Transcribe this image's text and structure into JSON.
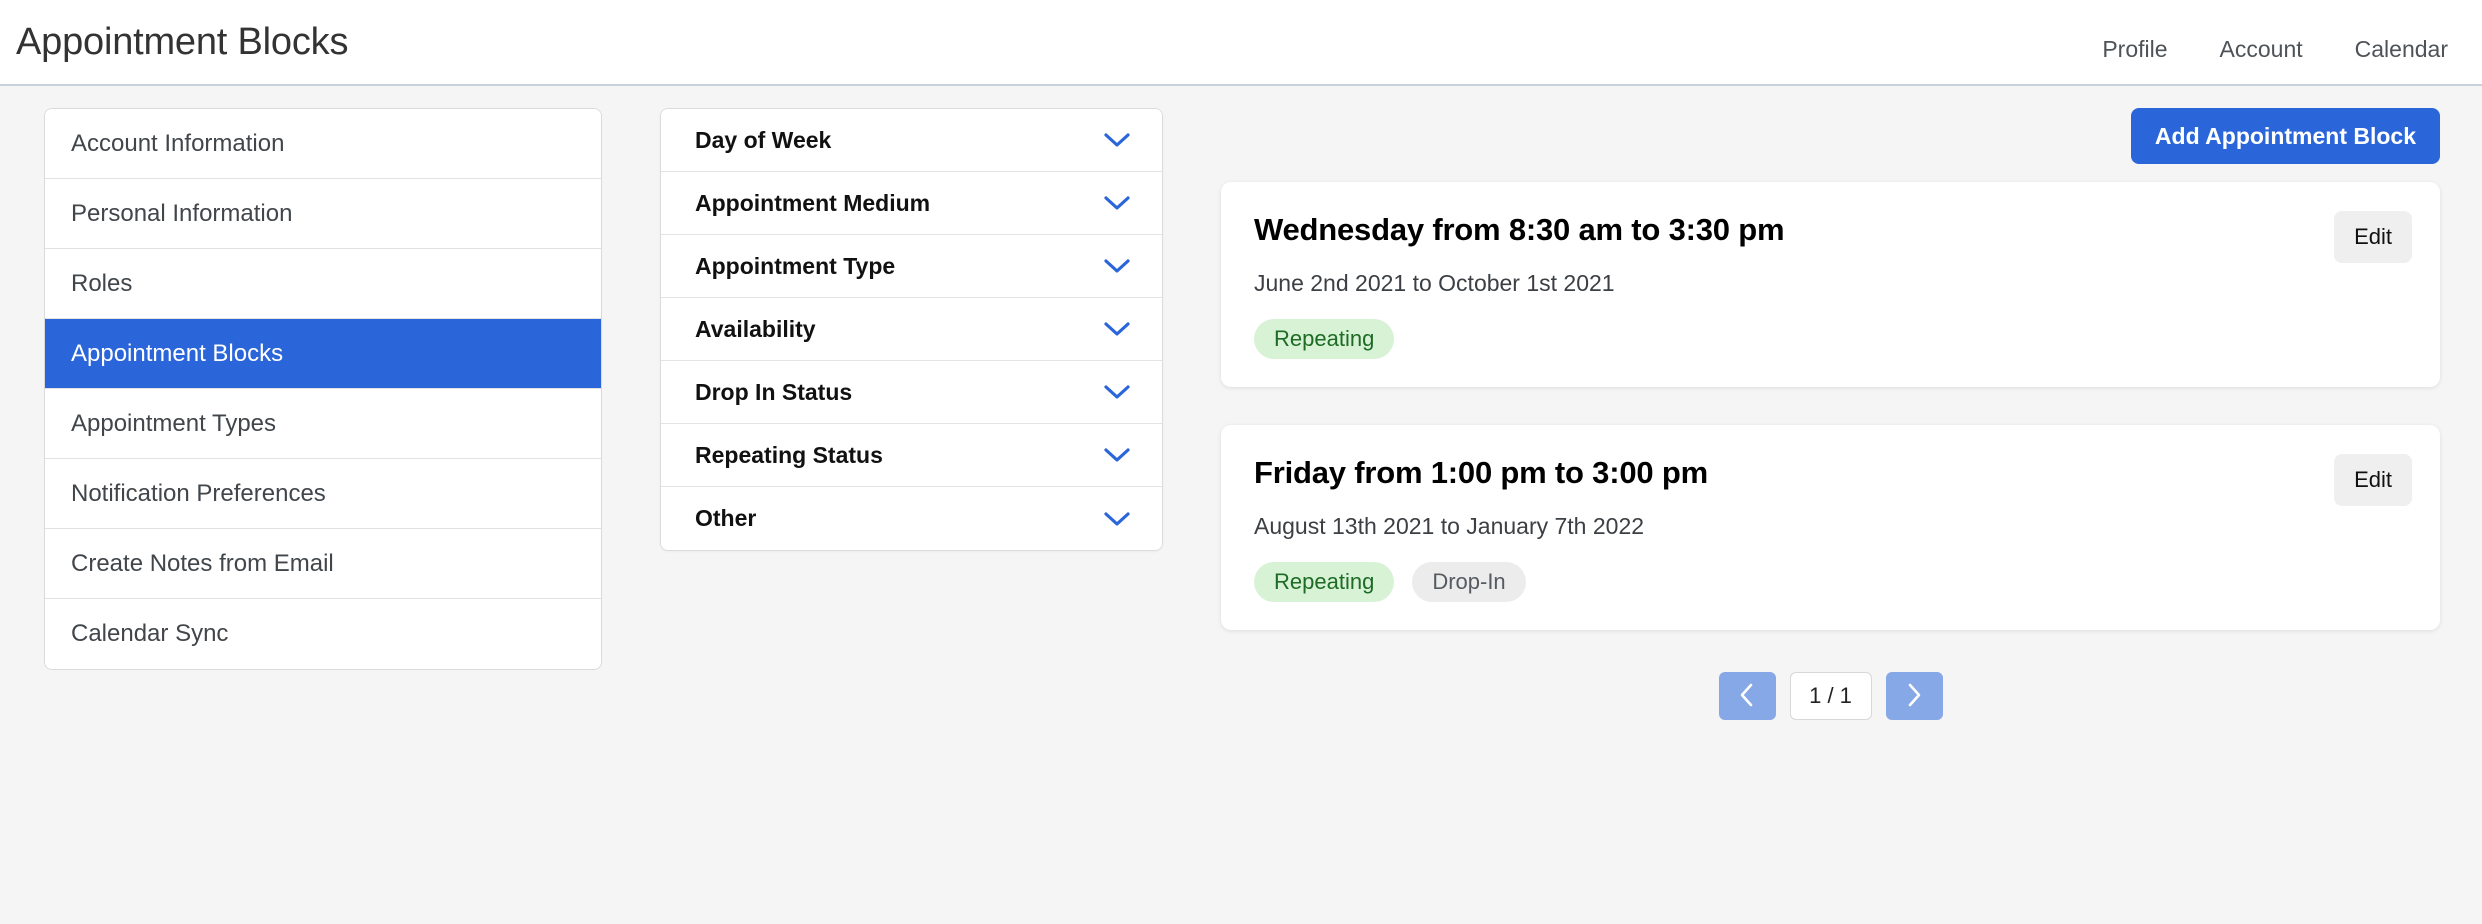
{
  "header": {
    "title": "Appointment Blocks",
    "nav": [
      {
        "label": "Profile"
      },
      {
        "label": "Account"
      },
      {
        "label": "Calendar"
      }
    ]
  },
  "settings_nav": {
    "items": [
      {
        "label": "Account Information",
        "active": false
      },
      {
        "label": "Personal Information",
        "active": false
      },
      {
        "label": "Roles",
        "active": false
      },
      {
        "label": "Appointment Blocks",
        "active": true
      },
      {
        "label": "Appointment Types",
        "active": false
      },
      {
        "label": "Notification Preferences",
        "active": false
      },
      {
        "label": "Create Notes from Email",
        "active": false
      },
      {
        "label": "Calendar Sync",
        "active": false
      }
    ]
  },
  "filters": {
    "icon": "chevron-down-icon",
    "accent_color": "#2a66d9",
    "rows": [
      {
        "label": "Day of Week"
      },
      {
        "label": "Appointment Medium"
      },
      {
        "label": "Appointment Type"
      },
      {
        "label": "Availability"
      },
      {
        "label": "Drop In Status"
      },
      {
        "label": "Repeating Status"
      },
      {
        "label": "Other"
      }
    ]
  },
  "toolbar": {
    "add_block_label": "Add Appointment Block",
    "add_block_color": "#2a66d9"
  },
  "blocks": [
    {
      "title": "Wednesday from 8:30 am to 3:30 pm",
      "date_range": "June 2nd 2021 to October 1st 2021",
      "edit_label": "Edit",
      "badges": [
        {
          "label": "Repeating",
          "style": "green"
        }
      ]
    },
    {
      "title": "Friday from 1:00 pm to 3:00 pm",
      "date_range": "August 13th 2021 to January 7th 2022",
      "edit_label": "Edit",
      "badges": [
        {
          "label": "Repeating",
          "style": "green"
        },
        {
          "label": "Drop-In",
          "style": "gray"
        }
      ]
    }
  ],
  "pagination": {
    "prev_icon": "chevron-left-icon",
    "next_icon": "chevron-right-icon",
    "indicator": "1 / 1",
    "arrow_color": "#86a8e7"
  }
}
